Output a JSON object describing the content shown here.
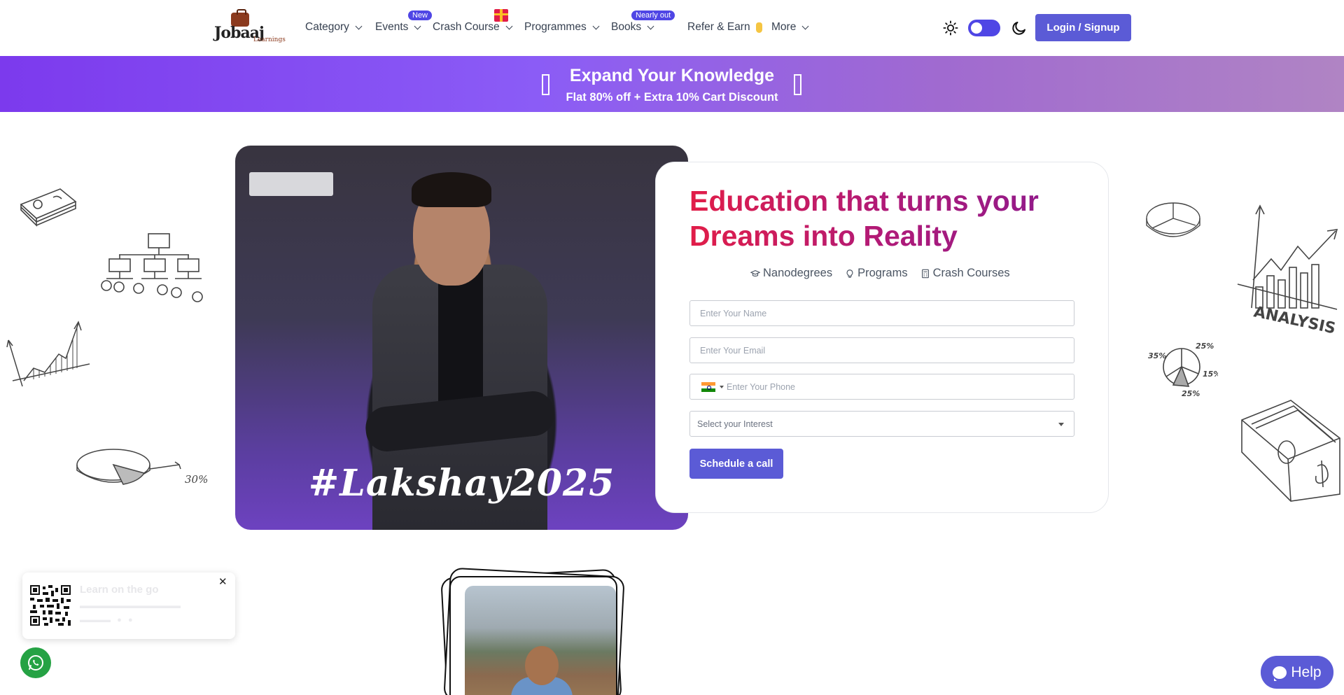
{
  "nav": {
    "logo_word": "Jobaaj",
    "logo_sub": "Learnings",
    "items": [
      {
        "label": "Category",
        "badge": ""
      },
      {
        "label": "Events",
        "badge": "New"
      },
      {
        "label": "Crash Course",
        "badge": ""
      },
      {
        "label": "Programmes",
        "badge": ""
      },
      {
        "label": "Books",
        "badge": "Nearly out"
      },
      {
        "label": "Refer & Earn",
        "badge": ""
      },
      {
        "label": "More",
        "badge": ""
      }
    ],
    "login_label": "Login / Signup",
    "accent": "#5b5bd6"
  },
  "banner": {
    "title": "Expand Your Knowledge",
    "subtitle": "Flat 80% off + Extra 10% Cart Discount"
  },
  "hero": {
    "hashtag": "#Lakshay2025",
    "headline": "Education that turns your Dreams into Reality",
    "offerings": [
      "Nanodegrees",
      "Programs",
      "Crash Courses"
    ],
    "form": {
      "name_placeholder": "Enter Your Name",
      "email_placeholder": "Enter Your Email",
      "phone_placeholder": "Enter Your Phone",
      "interest_placeholder": "Select your Interest",
      "submit_label": "Schedule a call"
    }
  },
  "doodles": {
    "analysis_label": "ANALYSIS",
    "percent_30": "30%",
    "pie_labels": [
      "25%",
      "35%",
      "15%",
      "25%"
    ]
  },
  "app_promo": {
    "title": "Learn on the go"
  },
  "help": {
    "label": "Help"
  }
}
